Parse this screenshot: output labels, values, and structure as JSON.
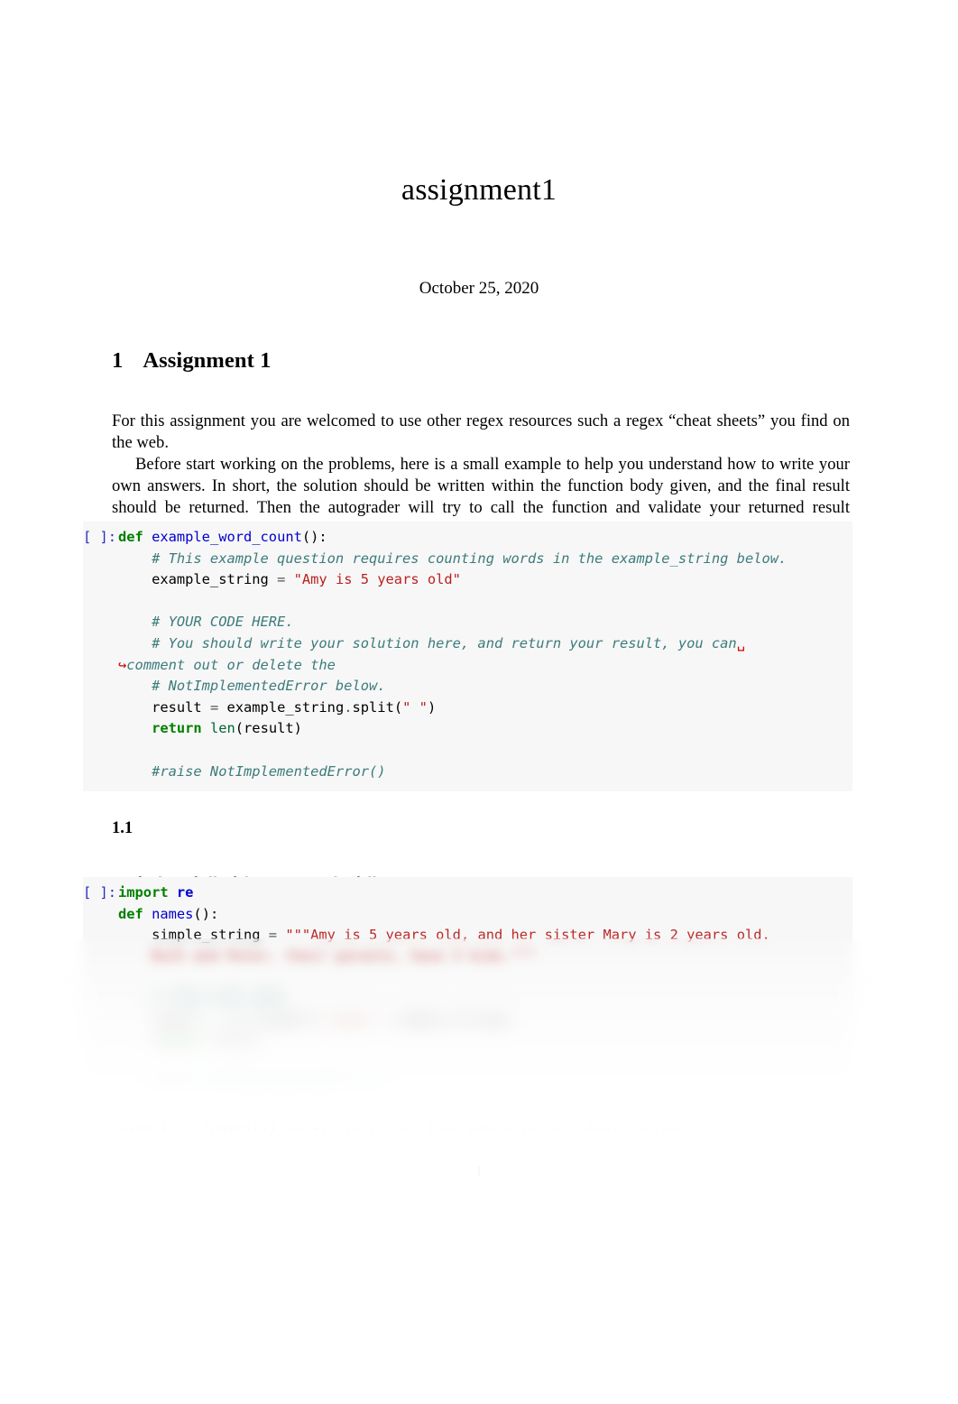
{
  "document": {
    "title": "assignment1",
    "date": "October 25, 2020",
    "page_number": "1"
  },
  "section": {
    "number": "1",
    "title": "Assignment 1",
    "paragraph_1": "For this assignment you are welcomed to use other regex resources such a regex “cheat sheets” you find on the web.",
    "paragraph_2": "Before start working on the problems, here is a small example to help you understand how to write your own answers. In short, the solution should be written within the function body given, and the final result should be returned. Then the autograder will try to call the function and validate your returned result accordingly."
  },
  "subsection": {
    "number": "1.1",
    "title": "",
    "paragraph": "Find a list of all of the names in the following string using regex."
  },
  "cells": [
    {
      "prompt": "[ ]:",
      "lines": [
        [
          {
            "t": "def ",
            "c": "k"
          },
          {
            "t": "example_word_count",
            "c": "nf"
          },
          {
            "t": "():",
            "c": "n"
          }
        ],
        [
          {
            "t": "    # This example question requires counting words in the example_string below.",
            "c": "c"
          }
        ],
        [
          {
            "t": "    example_string ",
            "c": "n"
          },
          {
            "t": "= ",
            "c": "o"
          },
          {
            "t": "\"Amy is 5 years old\"",
            "c": "s"
          }
        ],
        [
          {
            "t": "",
            "c": "n"
          }
        ],
        [
          {
            "t": "    # YOUR CODE HERE.",
            "c": "c"
          }
        ],
        [
          {
            "t": "    # You should write your solution here, and return your result, you can",
            "c": "c"
          },
          {
            "t": "␣",
            "c": "wrapmark"
          }
        ],
        [
          {
            "t": "↪",
            "c": "wrapmark"
          },
          {
            "t": "comment out or delete the",
            "c": "c"
          }
        ],
        [
          {
            "t": "    # NotImplementedError below.",
            "c": "c"
          }
        ],
        [
          {
            "t": "    result ",
            "c": "n"
          },
          {
            "t": "= ",
            "c": "o"
          },
          {
            "t": "example_string",
            "c": "n"
          },
          {
            "t": ".",
            "c": "o"
          },
          {
            "t": "split",
            "c": "n"
          },
          {
            "t": "(",
            "c": "n"
          },
          {
            "t": "\" \"",
            "c": "s"
          },
          {
            "t": ")",
            "c": "n"
          }
        ],
        [
          {
            "t": "    ",
            "c": "n"
          },
          {
            "t": "return ",
            "c": "k"
          },
          {
            "t": "len",
            "c": "nb"
          },
          {
            "t": "(result)",
            "c": "n"
          }
        ],
        [
          {
            "t": "",
            "c": "n"
          }
        ],
        [
          {
            "t": "    #raise NotImplementedError()",
            "c": "c"
          }
        ]
      ]
    },
    {
      "prompt": "[ ]:",
      "lines": [
        [
          {
            "t": "import ",
            "c": "k"
          },
          {
            "t": "re",
            "c": "nn"
          }
        ],
        [
          {
            "t": "def ",
            "c": "k"
          },
          {
            "t": "names",
            "c": "nf"
          },
          {
            "t": "():",
            "c": "n"
          }
        ],
        [
          {
            "t": "    simple_string ",
            "c": "n"
          },
          {
            "t": "= ",
            "c": "o"
          },
          {
            "t": "\"\"\"Amy is 5 years old, and her sister Mary is 2 years old.",
            "c": "s"
          }
        ],
        [
          {
            "t": "    Ruth and Peter, their parents, have 3 kids.\"\"\"",
            "c": "s"
          }
        ],
        [
          {
            "t": "",
            "c": "n"
          }
        ],
        [
          {
            "t": "    # YOUR CODE HERE",
            "c": "c"
          }
        ],
        [
          {
            "t": "    result ",
            "c": "n"
          },
          {
            "t": "= ",
            "c": "o"
          },
          {
            "t": "re",
            "c": "n"
          },
          {
            "t": ".",
            "c": "o"
          },
          {
            "t": "findall",
            "c": "n"
          },
          {
            "t": "(",
            "c": "n"
          },
          {
            "t": "\"regex\"",
            "c": "s"
          },
          {
            "t": ", simple_string)",
            "c": "n"
          }
        ],
        [
          {
            "t": "    ",
            "c": "n"
          },
          {
            "t": "return ",
            "c": "k"
          },
          {
            "t": "result",
            "c": "n"
          }
        ],
        [
          {
            "t": "",
            "c": "n"
          }
        ],
        [
          {
            "t": "    ",
            "c": "n"
          },
          {
            "t": "#raise NotImplementedError()",
            "c": "c"
          }
        ],
        [
          {
            "t": "",
            "c": "n"
          }
        ],
        [
          {
            "t": "assert ",
            "c": "k"
          },
          {
            "t": "len",
            "c": "nb"
          },
          {
            "t": "(names()) ",
            "c": "n"
          },
          {
            "t": "== ",
            "c": "o"
          },
          {
            "t": "4",
            "c": "n"
          },
          {
            "t": ", ",
            "c": "n"
          },
          {
            "t": "\"There are four names in the simple_string\"",
            "c": "s"
          }
        ]
      ]
    }
  ]
}
